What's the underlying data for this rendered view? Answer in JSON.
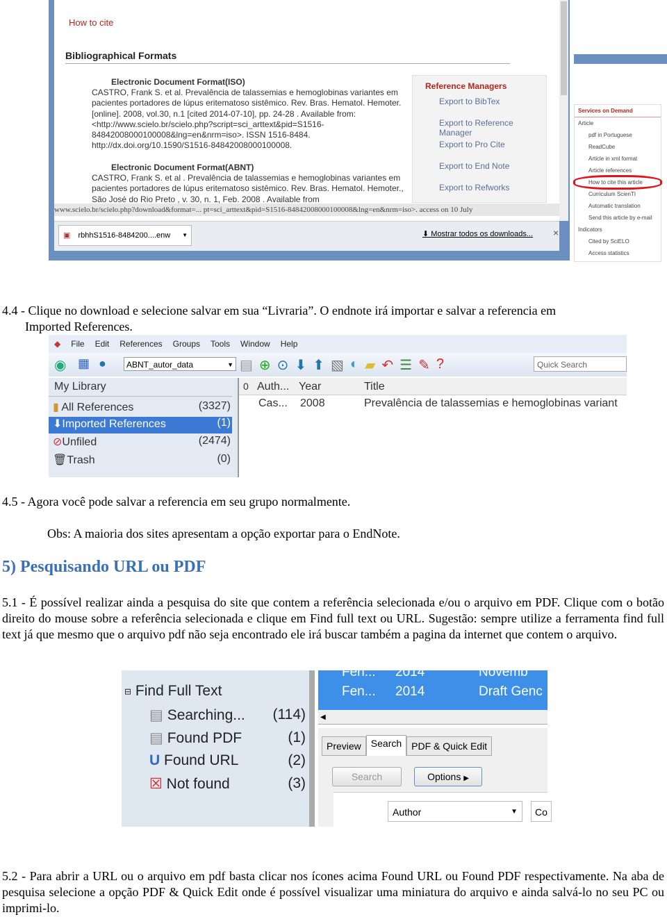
{
  "shot1": {
    "how_to_cite": "How to cite",
    "bib_formats": "Bibliographical Formats",
    "iso_title": "Electronic Document Format(ISO)",
    "iso_lines": [
      "CASTRO, Frank S. et al. Prevalência de talassemias e hemoglobinas variantes em",
      "pacientes portadores de lúpus eritematoso sistêmico. Rev. Bras. Hematol. Hemoter.",
      "[online]. 2008, vol.30, n.1 [cited  2014-07-10], pp. 24-28 . Available from:",
      "<http://www.scielo.br/scielo.php?script=sci_arttext&pid=S1516-",
      "84842008000100008&lng=en&nrm=iso>. ISSN 1516-8484.",
      "http://dx.doi.org/10.1590/S1516-84842008000100008."
    ],
    "abnt_title": "Electronic Document Format(ABNT)",
    "abnt_lines": [
      "CASTRO, Frank S. et al . Prevalência de talassemias e hemoglobinas variantes em",
      "pacientes portadores de lúpus eritematoso sistêmico. Rev. Bras. Hematol. Hemoter.,",
      "São José do Rio Preto ,  v. 30, n. 1, Feb.  2008 .   Available from"
    ],
    "status_url": "www.scielo.br/scielo.php?download&format=... pt=sci_arttext&pid=S1516-84842008000100008&lng=en&nrm=iso>. access on  10  July",
    "ref_managers": "Reference Managers",
    "exports": [
      "Export to BibTex",
      "Export to Reference Manager",
      "Export to Pro Cite",
      "Export to End Note",
      "Export to Refworks"
    ],
    "download_file": "rbhhS1516-8484200....enw",
    "show_all": "Mostrar todos os downloads...",
    "close": "×",
    "services": "Services on Demand",
    "article": "Article",
    "services_items": [
      "pdf in Portuguese",
      "ReadCube",
      "Article in xml format",
      "Article references",
      "How to cite this article",
      "Curriculum ScienTI",
      "Automatic translation",
      "Send this article by e-mail"
    ],
    "indicators": "Indicators",
    "indicator_items": [
      "Cited by SciELO",
      "Access statistics"
    ],
    "highlight_color": "#e0141a"
  },
  "p44": [
    "4.4 - Clique no download e selecione salvar em sua “Livraria”. O endnote irá importar e salvar a referencia em",
    "Imported References."
  ],
  "shot2": {
    "menu": [
      "File",
      "Edit",
      "References",
      "Groups",
      "Tools",
      "Window",
      "Help"
    ],
    "style": "ABNT_autor_data",
    "quick_search": "Quick Search",
    "my_library": "My Library",
    "groups": [
      {
        "name": "All References",
        "count": "(3327)"
      },
      {
        "name": "Imported References",
        "count": "(1)"
      },
      {
        "name": "Unfiled",
        "count": "(2474)"
      },
      {
        "name": "Trash",
        "count": "(0)"
      }
    ],
    "cols": [
      "0",
      "Auth...",
      "Year",
      "Title"
    ],
    "row": [
      "Cas...",
      "2008",
      "Prevalência de talassemias e hemoglobinas variant"
    ]
  },
  "p45": "4.5 - Agora você pode salvar a referencia em seu grupo normalmente.",
  "obs": "Obs: A maioria dos sites apresentam a opção exportar para o EndNote.",
  "heading": "5) Pesquisando URL ou PDF",
  "p51": "5.1 - É possível realizar ainda a pesquisa do site que contem a referência selecionada e/ou o arquivo em PDF. Clique com o botão direito do mouse sobre a referência selecionada e clique em Find full text ou URL. Sugestão: sempre utilize a ferramenta find full text já que mesmo que o arquivo pdf não seja encontrado ele irá buscar também a pagina da internet que contem o arquivo.",
  "shot3": {
    "title": "Find Full Text",
    "items": [
      {
        "name": "Searching...",
        "count": "(114)"
      },
      {
        "name": "Found PDF",
        "count": "(1)"
      },
      {
        "name": "Found URL",
        "count": "(2)"
      },
      {
        "name": "Not found",
        "count": "(3)"
      }
    ],
    "rows": [
      [
        "Fen...",
        "2014",
        "Novemb"
      ],
      [
        "Fen...",
        "2014",
        "Draft Genc"
      ]
    ],
    "tabs": [
      "Preview",
      "Search",
      "PDF & Quick Edit"
    ],
    "search_btn": "Search",
    "options_btn": "Options",
    "field": "Author",
    "co": "Co"
  },
  "p52": "5.2 - Para abrir a URL ou o arquivo em pdf basta clicar nos ícones acima Found URL ou Found PDF respectivamente. Na aba de pesquisa selecione a opção PDF & Quick Edit onde é possível visualizar uma miniatura do arquivo e ainda salvá-lo no seu PC ou imprimi-lo."
}
